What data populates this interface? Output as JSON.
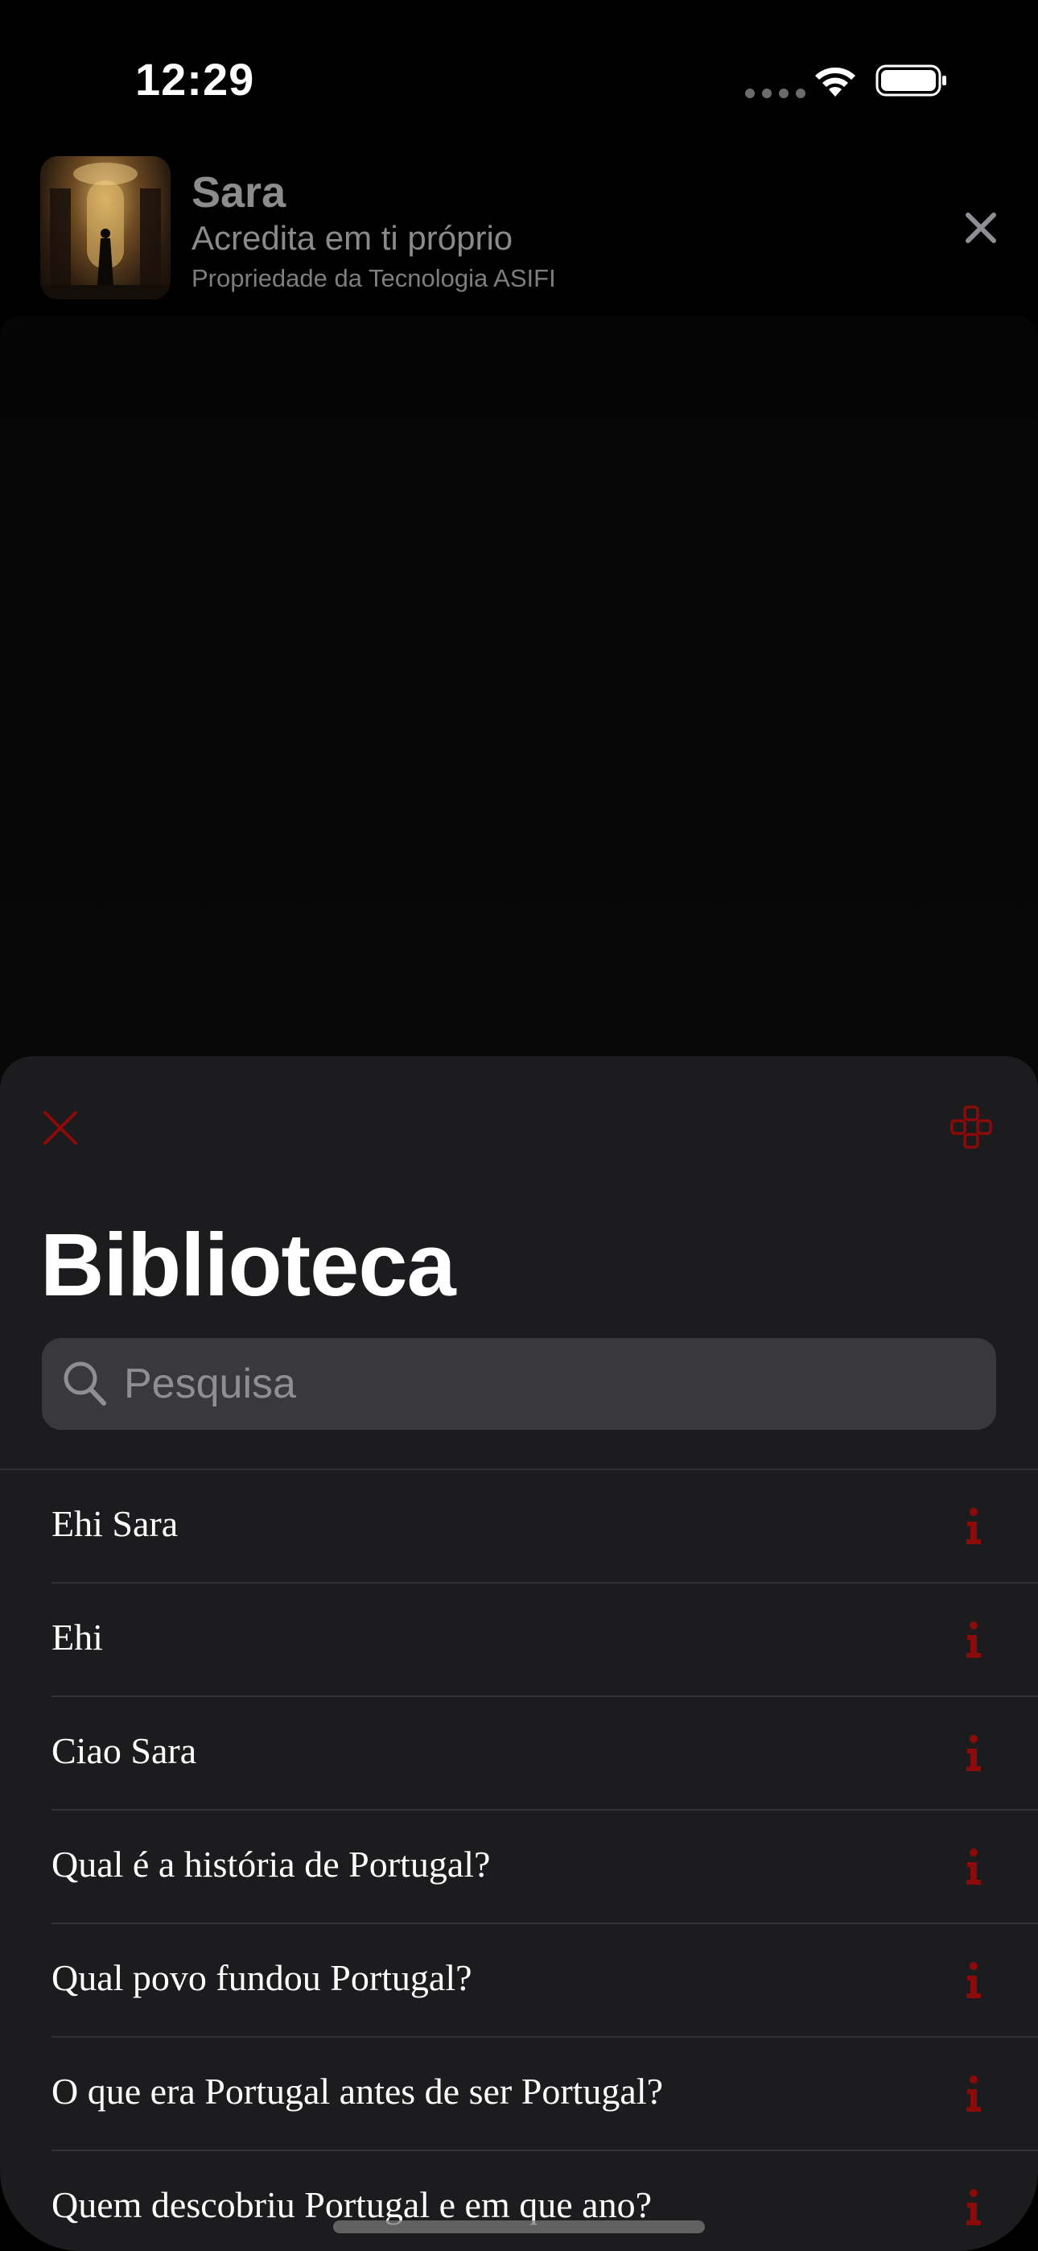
{
  "status_bar": {
    "time": "12:29"
  },
  "banner": {
    "title": "Sara",
    "subtitle": "Acredita em ti próprio",
    "caption": "Propriedade da Tecnologia ASIFI"
  },
  "sheet": {
    "title": "Biblioteca",
    "search": {
      "placeholder": "Pesquisa",
      "value": ""
    },
    "items": [
      {
        "label": "Ehi Sara"
      },
      {
        "label": "Ehi"
      },
      {
        "label": "Ciao Sara"
      },
      {
        "label": "Qual é a história de Portugal?"
      },
      {
        "label": "Qual povo fundou Portugal?"
      },
      {
        "label": "O que era Portugal antes de ser Portugal?"
      },
      {
        "label": "Quem descobriu Portugal e em que ano?"
      }
    ]
  },
  "colors": {
    "accent": "#8b0a0a",
    "sheet_background": "#1c1c1e",
    "search_background": "#39393d"
  },
  "icons": {
    "close_sheet": "close-icon",
    "options": "gamepad-icon",
    "search": "search-icon",
    "row_info": "info-icon",
    "banner_close": "close-icon"
  }
}
